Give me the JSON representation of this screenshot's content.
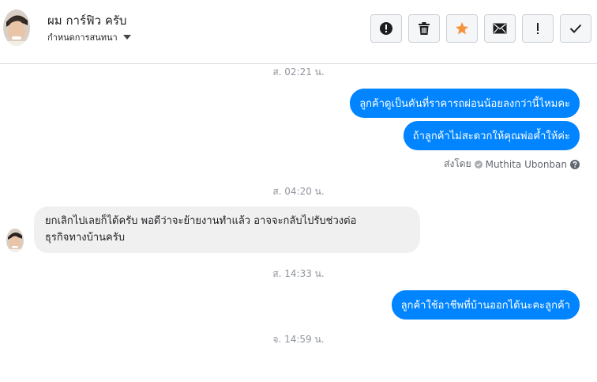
{
  "header": {
    "contact_name": "ผม การ์ฟิว ครับ",
    "subtitle": "กำหนดการสนทนา",
    "toolbar": [
      {
        "name": "report-button",
        "icon": "alert-circle-icon"
      },
      {
        "name": "delete-button",
        "icon": "trash-icon"
      },
      {
        "name": "star-button",
        "icon": "star-icon"
      },
      {
        "name": "mark-unread-button",
        "icon": "envelope-icon"
      },
      {
        "name": "spam-button",
        "icon": "exclamation-icon"
      },
      {
        "name": "mark-done-button",
        "icon": "checkmark-icon"
      }
    ]
  },
  "conversation": {
    "timestamps": [
      "ส. 02:21 น.",
      "ส. 04:20 น.",
      "ส. 14:33 น.",
      "จ. 14:59 น."
    ],
    "outgoing": [
      "ลูกค้าดูเป็นคันที่ราคารถผ่อนน้อยลงกว่านี้ไหมคะ",
      "ถ้าลูกค้าไม่สะดวกให้คุณพ่อค้ำให้ค่ะ",
      "ลูกค้าใช้อาชีพที่บ้านออกได้นะคะลูกค้า"
    ],
    "sent_by_label": "ส่งโดย",
    "sent_by_name": "Muthita Ubonban",
    "incoming": [
      {
        "line1": "ยกเลิกไปเลยก็ได้ครับ พอดีว่าจะย้ายงานทำแล้ว อาจจะกลับไปรับช่วงต่อ",
        "line2": "ธุรกิจทางบ้านครับ"
      }
    ]
  },
  "colors": {
    "accent": "#0084ff",
    "incoming_bubble": "#f1f0f0",
    "star": "#f7923b"
  }
}
